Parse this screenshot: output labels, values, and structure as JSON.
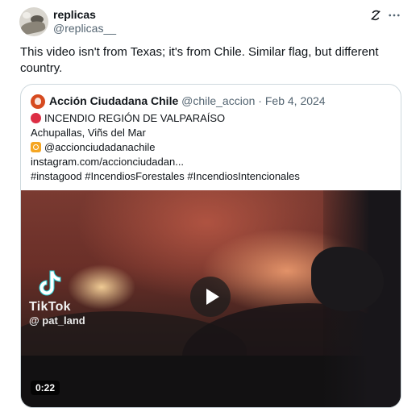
{
  "tweet": {
    "author_name": "replicas",
    "author_handle": "@replicas__",
    "icons": {
      "grok": "grok-icon",
      "more": "more-icon"
    },
    "text": "This video isn't from Texas; it's from Chile. Similar flag, but different country."
  },
  "quote": {
    "author_name": "Acción Ciudadana Chile",
    "author_handle": "@chile_accion",
    "separator": "·",
    "date": "Feb 4, 2024",
    "lines": [
      "INCENDIO REGIÓN DE VALPARAÍSO",
      "Achupallas, Viñs del Mar",
      "@accionciudadanachile",
      "instagram.com/accionciudadan...",
      "#instagood #IncendiosForestales #IncendiosIntencionales"
    ],
    "line_icons": [
      "red-circle-icon",
      "",
      "instagram-icon",
      "",
      ""
    ],
    "media": {
      "watermark_brand": "TikTok",
      "watermark_user": "@ pat_land",
      "duration": "0:22",
      "play_icon": "play-icon"
    }
  },
  "colors": {
    "text_primary": "#0f1419",
    "text_secondary": "#536471",
    "border": "#cfd9de",
    "red_circle": "#dd2e44"
  }
}
